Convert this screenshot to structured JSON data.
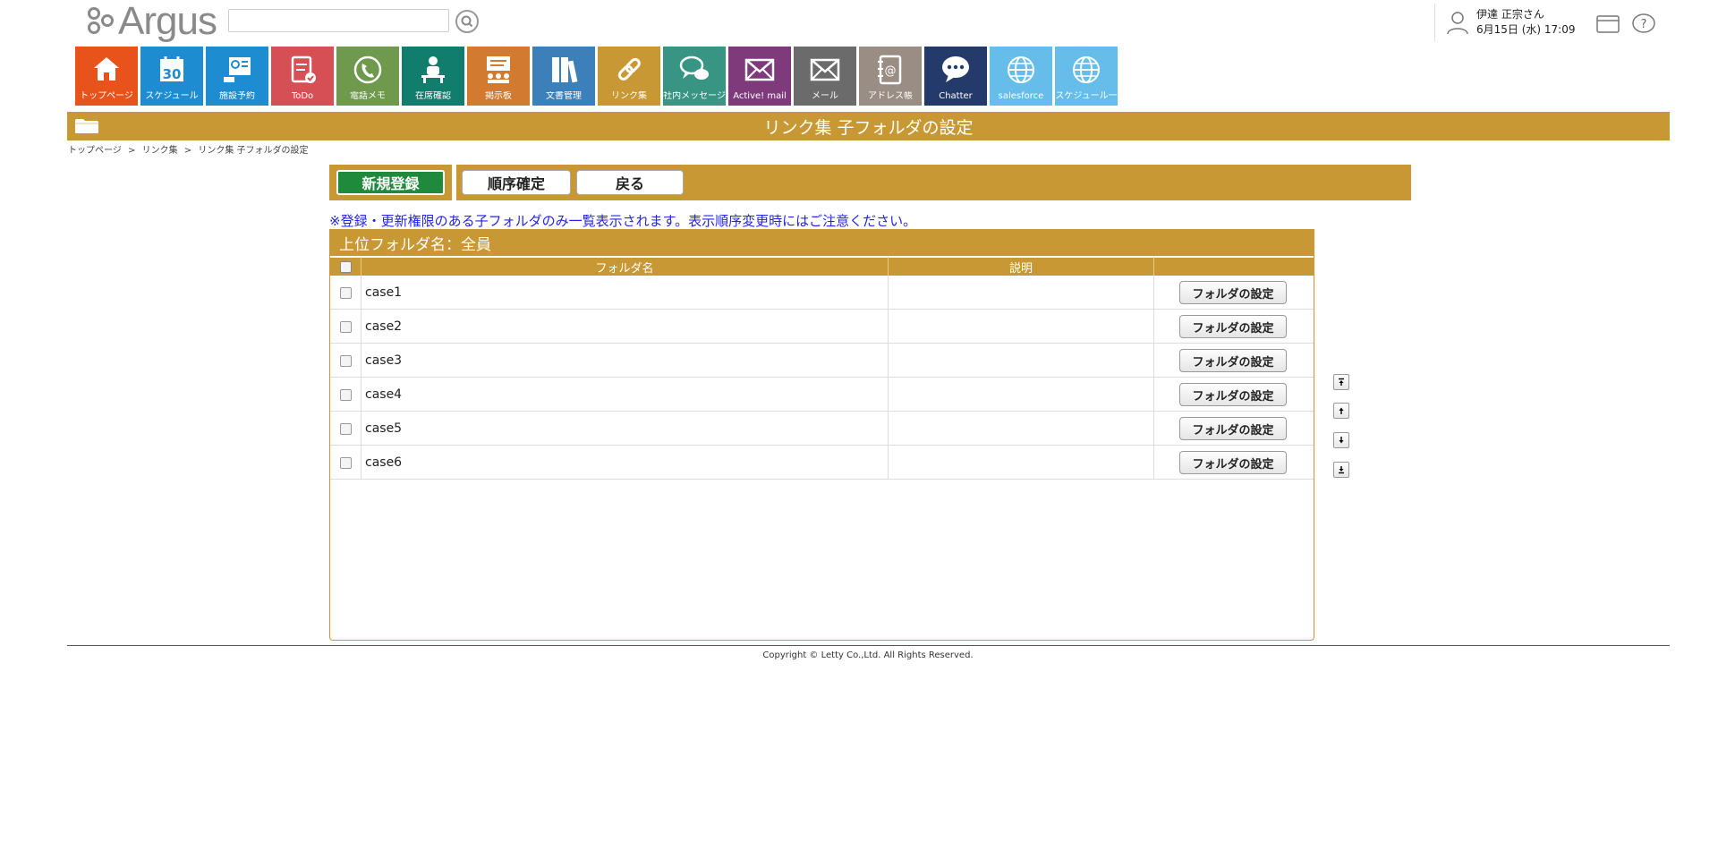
{
  "header": {
    "logo_text": "Argus",
    "search_placeholder": "",
    "user_name": "伊達 正宗さん",
    "datetime": "6月15日 (水) 17:09"
  },
  "apps": [
    {
      "label": "トップページ",
      "icon": "home-icon",
      "color": "#e8531c"
    },
    {
      "label": "スケジュール",
      "icon": "calendar-icon",
      "color": "#1e8cd0"
    },
    {
      "label": "施設予約",
      "icon": "facility-icon",
      "color": "#1e8cd0"
    },
    {
      "label": "ToDo",
      "icon": "todo-icon",
      "color": "#d64f55"
    },
    {
      "label": "電話メモ",
      "icon": "phone-icon",
      "color": "#6f9a4e"
    },
    {
      "label": "在席確認",
      "icon": "presence-icon",
      "color": "#107d6d"
    },
    {
      "label": "掲示板",
      "icon": "board-icon",
      "color": "#d27a2f"
    },
    {
      "label": "文書管理",
      "icon": "document-icon",
      "color": "#3c7fb9"
    },
    {
      "label": "リンク集",
      "icon": "link-icon",
      "color": "#c79834"
    },
    {
      "label": "社内メッセージ",
      "icon": "message-icon",
      "color": "#389583"
    },
    {
      "label": "Active! mail",
      "icon": "mail-icon",
      "color": "#7e3a7b"
    },
    {
      "label": "メール",
      "icon": "mail-icon",
      "color": "#6b6b6b"
    },
    {
      "label": "アドレス帳",
      "icon": "address-book-icon",
      "color": "#9a8d84"
    },
    {
      "label": "Chatter",
      "icon": "chat-icon",
      "color": "#233a6a"
    },
    {
      "label": "salesforce",
      "icon": "globe-icon",
      "color": "#66bde9"
    },
    {
      "label": "スケジュール一",
      "icon": "globe-icon",
      "color": "#66bde9"
    }
  ],
  "page": {
    "title": "リンク集 子フォルダの設定",
    "breadcrumb": [
      "トップページ",
      ">",
      "リンク集",
      ">",
      "リンク集 子フォルダの設定"
    ]
  },
  "actions": {
    "new": "新規登録",
    "order_confirm": "順序確定",
    "back": "戻る"
  },
  "notice": "※登録・更新権限のある子フォルダのみ一覧表示されます。表示順序変更時にはご注意ください。",
  "table": {
    "parent_label": "上位フォルダ名：全員",
    "columns": [
      "フォルダ名",
      "説明"
    ],
    "rows": [
      {
        "name": "case1",
        "description": "",
        "button": "フォルダの設定"
      },
      {
        "name": "case2",
        "description": "",
        "button": "フォルダの設定"
      },
      {
        "name": "case3",
        "description": "",
        "button": "フォルダの設定"
      },
      {
        "name": "case4",
        "description": "",
        "button": "フォルダの設定"
      },
      {
        "name": "case5",
        "description": "",
        "button": "フォルダの設定"
      },
      {
        "name": "case6",
        "description": "",
        "button": "フォルダの設定"
      }
    ]
  },
  "footer": {
    "copyright": "Copyright © Letty Co.,Ltd. All Rights Reserved."
  }
}
